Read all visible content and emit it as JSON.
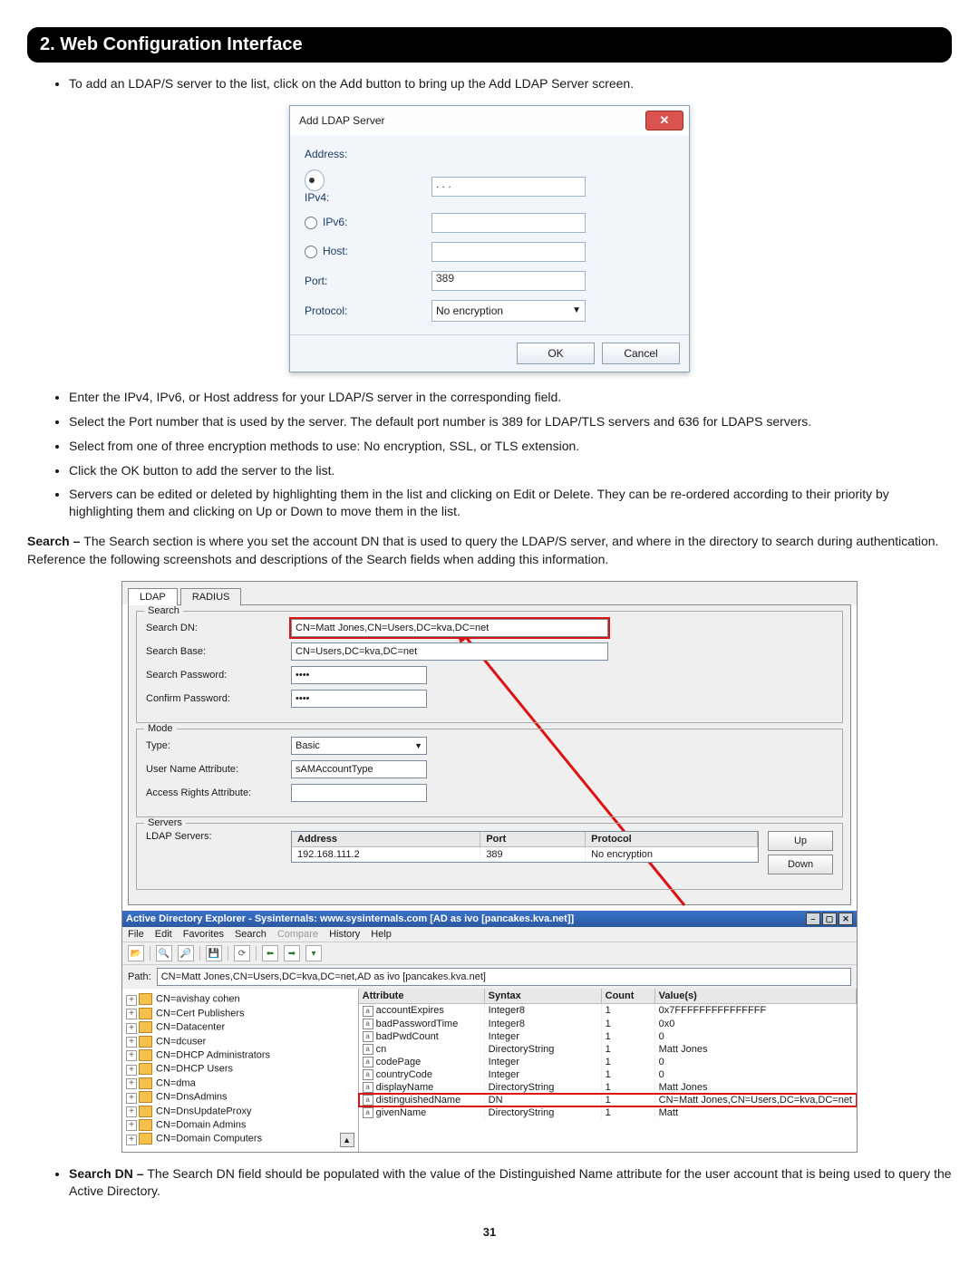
{
  "section_title": "2. Web Configuration Interface",
  "intro_bullets": [
    "To add an LDAP/S server to the list, click on the Add button to bring up the Add LDAP Server screen."
  ],
  "dialog": {
    "title": "Add LDAP Server",
    "labels": {
      "address": "Address:",
      "ipv4": "IPv4:",
      "ipv6": "IPv6:",
      "host": "Host:",
      "port": "Port:",
      "protocol": "Protocol:"
    },
    "values": {
      "ipv4": ".   .   .",
      "ipv6": "",
      "host": "",
      "port": "389",
      "protocol": "No encryption"
    },
    "buttons": {
      "ok": "OK",
      "cancel": "Cancel"
    }
  },
  "post_dialog_bullets": [
    "Enter the IPv4, IPv6, or Host address for your LDAP/S server in the corresponding field.",
    "Select the Port number that is used by the server. The default port number is 389 for LDAP/TLS servers and 636 for LDAPS servers.",
    "Select from one of three encryption methods to use: No encryption, SSL, or TLS extension.",
    "Click the OK button to add the server to the list.",
    "Servers can be edited or deleted by highlighting them in the list and clicking on Edit or Delete. They can be re-ordered according to their priority by highlighting them and clicking on Up or Down to move them in the list."
  ],
  "search_para_lead": "Search – ",
  "search_para": "The Search section is where you set the account DN that is used to query the LDAP/S server, and where in the directory to search during authentication. Reference the following screenshots and descriptions of the Search fields when adding this information.",
  "shot2": {
    "tabs": {
      "ldap": "LDAP",
      "radius": "RADIUS"
    },
    "groups": {
      "search": "Search",
      "mode": "Mode",
      "servers": "Servers"
    },
    "fields": {
      "search_dn_label": "Search DN:",
      "search_dn_value": "CN=Matt Jones,CN=Users,DC=kva,DC=net",
      "search_base_label": "Search Base:",
      "search_base_value": "CN=Users,DC=kva,DC=net",
      "search_pw_label": "Search Password:",
      "search_pw_value": "••••",
      "confirm_pw_label": "Confirm Password:",
      "confirm_pw_value": "••••",
      "type_label": "Type:",
      "type_value": "Basic",
      "una_label": "User Name Attribute:",
      "una_value": "sAMAccountType",
      "ara_label": "Access Rights Attribute:",
      "ara_value": "",
      "ldap_servers_label": "LDAP Servers:"
    },
    "server_table": {
      "headers": {
        "address": "Address",
        "port": "Port",
        "protocol": "Protocol"
      },
      "row": {
        "address": "192.168.111.2",
        "port": "389",
        "protocol": "No encryption"
      },
      "buttons": {
        "up": "Up",
        "down": "Down"
      }
    },
    "ade": {
      "title": "Active Directory Explorer - Sysinternals: www.sysinternals.com [AD as ivo [pancakes.kva.net]]",
      "menus": {
        "file": "File",
        "edit": "Edit",
        "fav": "Favorites",
        "search": "Search",
        "compare": "Compare",
        "history": "History",
        "help": "Help"
      },
      "path_label": "Path:",
      "path_value": "CN=Matt Jones,CN=Users,DC=kva,DC=net,AD as ivo [pancakes.kva.net]",
      "tree": [
        "CN=avishay cohen",
        "CN=Cert Publishers",
        "CN=Datacenter",
        "CN=dcuser",
        "CN=DHCP Administrators",
        "CN=DHCP Users",
        "CN=dma",
        "CN=DnsAdmins",
        "CN=DnsUpdateProxy",
        "CN=Domain Admins",
        "CN=Domain Computers"
      ],
      "attr_headers": {
        "attr": "Attribute",
        "syntax": "Syntax",
        "count": "Count",
        "values": "Value(s)"
      },
      "attrs": [
        {
          "a": "accountExpires",
          "s": "Integer8",
          "c": "1",
          "v": "0x7FFFFFFFFFFFFFFF"
        },
        {
          "a": "badPasswordTime",
          "s": "Integer8",
          "c": "1",
          "v": "0x0"
        },
        {
          "a": "badPwdCount",
          "s": "Integer",
          "c": "1",
          "v": "0"
        },
        {
          "a": "cn",
          "s": "DirectoryString",
          "c": "1",
          "v": "Matt Jones"
        },
        {
          "a": "codePage",
          "s": "Integer",
          "c": "1",
          "v": "0"
        },
        {
          "a": "countryCode",
          "s": "Integer",
          "c": "1",
          "v": "0"
        },
        {
          "a": "displayName",
          "s": "DirectoryString",
          "c": "1",
          "v": "Matt Jones"
        },
        {
          "a": "distinguishedName",
          "s": "DN",
          "c": "1",
          "v": "CN=Matt Jones,CN=Users,DC=kva,DC=net"
        },
        {
          "a": "givenName",
          "s": "DirectoryString",
          "c": "1",
          "v": "Matt"
        }
      ]
    }
  },
  "final_bullet_lead": "Search DN – ",
  "final_bullet": "The Search DN field should be populated with the value of the Distinguished Name attribute for the user account that is being used to query the Active Directory.",
  "page_number": "31"
}
